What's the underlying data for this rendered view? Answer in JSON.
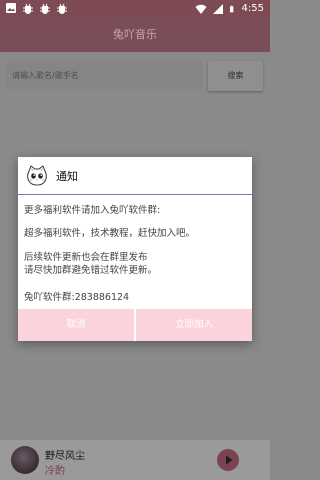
{
  "status_bar": {
    "time": "4:55"
  },
  "appbar": {
    "title": "兔吖音乐"
  },
  "search": {
    "placeholder": "请输入歌名/歌手名",
    "button_label": "搜索"
  },
  "dialog": {
    "title": "通知",
    "lines": [
      "更多福利软件请加入兔吖软件群:",
      "超多福利软件，技术教程，赶快加入吧。",
      "后续软件更新也会在群里发布",
      "请尽快加群避免错过软件更新。",
      "兔吖软件群:283886124"
    ],
    "cancel_label": "取消",
    "join_label": "立即加入"
  },
  "player": {
    "title": "野尽风尘",
    "artist": "冷酌"
  },
  "colors": {
    "accent": "#7b4d56",
    "dialog_button": "#fbd3db",
    "player_artist": "#7a3c47"
  }
}
